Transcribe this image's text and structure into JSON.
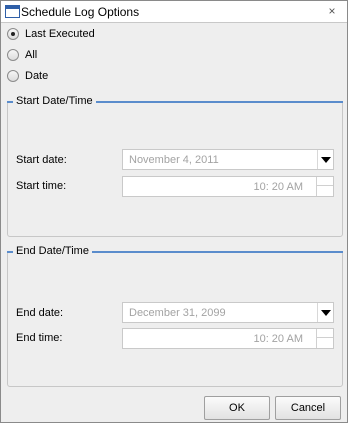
{
  "window": {
    "title": "Schedule Log Options",
    "close_glyph": "×"
  },
  "log_options": {
    "selected": "Last Executed",
    "options": [
      "Last Executed",
      "All",
      "Date"
    ]
  },
  "start_group": {
    "title": "Start Date/Time",
    "date_label": "Start date:",
    "date_value": "November 4, 2011",
    "time_label": "Start time:",
    "time_value": "10: 20 AM"
  },
  "end_group": {
    "title": "End Date/Time",
    "date_label": "End date:",
    "date_value": "December 31, 2099",
    "time_label": "End time:",
    "time_value": "10: 20 AM"
  },
  "buttons": {
    "ok": "OK",
    "cancel": "Cancel"
  },
  "icons": {
    "window": "window-icon",
    "close": "close-icon",
    "dropdown": "chevron-down-icon"
  }
}
